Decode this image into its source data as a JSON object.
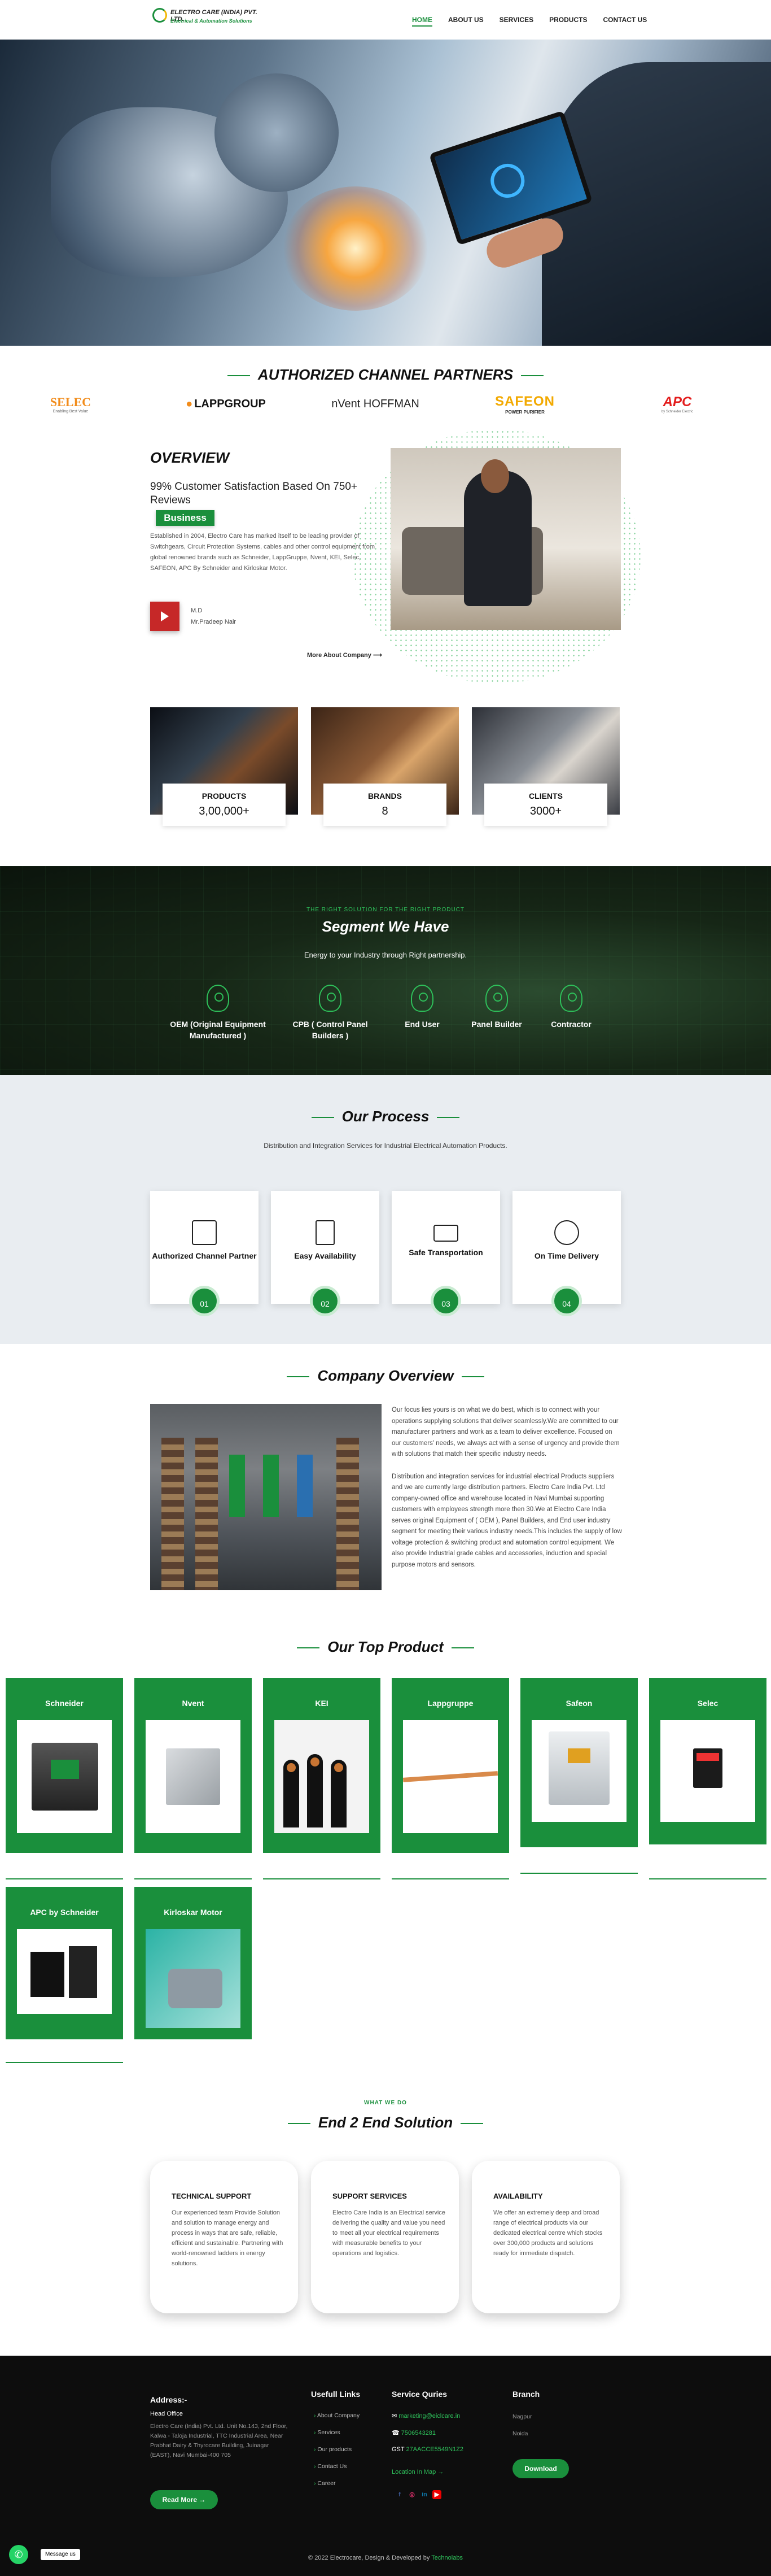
{
  "brand": {
    "line1": "ELECTRO CARE (INDIA) PVT. LTD.",
    "line2": "Electrical & Automation Solutions",
    "accent": "#1a8f3c"
  },
  "nav": [
    "HOME",
    "ABOUT US",
    "SERVICES",
    "PRODUCTS",
    "CONTACT US"
  ],
  "partners": {
    "title": "AUTHORIZED CHANNEL PARTNERS",
    "logos": [
      "SELEC",
      "LAPPGROUP",
      "nVent HOFFMAN",
      "SAFEON",
      "APC"
    ],
    "selec_tag": "Enabling Best Value",
    "safeon_tag": "POWER PURIFIER",
    "apc_tag": "by Schneider Electric"
  },
  "overview": {
    "title": "OVERVIEW",
    "subtitle": "99% Customer Satisfaction Based On 750+ Reviews",
    "badge": "Business",
    "paragraph": "Established in 2004, Electro Care has marked itself to be leading provider of Switchgears, Circuit Protection Systems, cables and other control equipment from global renowned brands such as Schneider, LappGruppe, Nvent, KEI, Selec, SAFEON, APC By Schneider and Kirloskar Motor.",
    "md_title": "M.D",
    "md_name": "Mr.Pradeep Nair",
    "more": "More About Company"
  },
  "stats": [
    {
      "label": "PRODUCTS",
      "value": "3,00,000+"
    },
    {
      "label": "BRANDS",
      "value": "8"
    },
    {
      "label": "CLIENTS",
      "value": "3000+"
    }
  ],
  "segments": {
    "kicker": "THE RIGHT SOLUTION FOR THE RIGHT PRODUCT",
    "title": "Segment We Have",
    "subtitle": "Energy to your Industry through Right partnership.",
    "items": [
      "OEM (Original Equipment Manufactured )",
      "CPB ( Control Panel Builders )",
      "End User",
      "Panel Builder",
      "Contractor"
    ]
  },
  "process": {
    "title": "Our Process",
    "subtitle": "Distribution and Integration Services for Industrial Electrical Automation Products.",
    "steps": [
      {
        "label": "Authorized Channel Partner",
        "num": "01"
      },
      {
        "label": "Easy Availability",
        "num": "02"
      },
      {
        "label": "Safe Transportation",
        "num": "03"
      },
      {
        "label": "On Time Delivery",
        "num": "04"
      }
    ]
  },
  "company": {
    "title": "Company Overview",
    "p1": "Our focus lies yours is on what we do best, which is to connect with your operations supplying solutions that deliver seamlessly.We are committed to our manufacturer partners and work as a team to deliver excellence. Focused on our customers' needs, we always act with a sense of urgency and provide them with solutions that match their specific industry needs.",
    "p2": "Distribution and integration services for industrial electrical Products suppliers and we are currently large distribution partners. Electro Care India Pvt. Ltd company-owned office and warehouse located in Navi Mumbai supporting customers with employees strength more then 30.We at Electro Care India serves original Equipment of ( OEM ), Panel Builders, and End user industry segment for meeting their various industry needs.This includes the supply of low voltage protection & switching product and automation control equipment. We also provide Industrial grade cables and accessories, induction and special purpose motors and sensors."
  },
  "products": {
    "title": "Our Top Product",
    "items": [
      "Schneider",
      "Nvent",
      "KEI",
      "Lappgruppe",
      "Safeon",
      "Selec",
      "APC by Schneider",
      "Kirloskar Motor"
    ]
  },
  "e2e": {
    "kicker": "WHAT WE DO",
    "title": "End 2 End Solution",
    "cards": [
      {
        "title": "TECHNICAL SUPPORT",
        "desc": "Our experienced team Provide Solution and solution to manage energy and process in ways that are safe, reliable, efficient and sustainable. Partnering with world-renowned ladders in energy solutions."
      },
      {
        "title": "SUPPORT SERVICES",
        "desc": "Electro Care India is an Electrical service delivering the quality and value you need to meet all your electrical requirements with measurable benefits to your operations and logistics."
      },
      {
        "title": "AVAILABILITY",
        "desc": "We offer an extremely deep and broad range of electrical products via our dedicated electrical centre which stocks over 300,000 products and solutions ready for immediate dispatch."
      }
    ]
  },
  "footer": {
    "address_title": "Address:-",
    "office": "Head Office",
    "address": "Electro Care (India) Pvt. Ltd. Unit No.143, 2nd Floor, Kalwa - Taloja Industrial, TTC Industrial Area, Near Prabhat Dairy & Thyrocare Building, Juinagar (EAST), Navi Mumbai-400 705",
    "read_more": "Read More",
    "links_title": "Usefull Links",
    "links": [
      "About Company",
      "Services",
      "Our products",
      "Contact Us",
      "Career"
    ],
    "service_title": "Service Quries",
    "email": "marketing@eiclcare.in",
    "phone": "7506543281",
    "gst_label": "GST",
    "gst": "27AACCE5549N1Z2",
    "location": "Location In Map",
    "branch_title": "Branch",
    "branches": [
      "Nagpur",
      "Noida"
    ],
    "download": "Download",
    "copyright": "© 2022 Electrocare, Design & Developed by",
    "dev": "Technolabs",
    "whatsapp": "Message us"
  }
}
